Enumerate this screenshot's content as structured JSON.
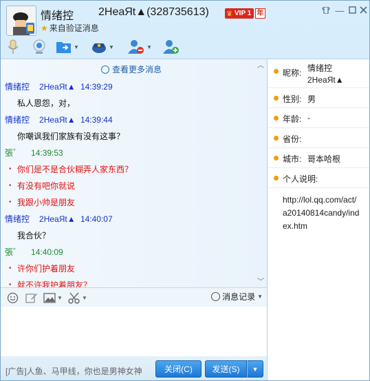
{
  "window": {
    "contact_name": "情绪控",
    "peer_label": "2HeaЯt▲(328735613)",
    "vip_badge": "VIP 1",
    "vip_year": "年",
    "verify_text": "来自验证消息"
  },
  "chat": {
    "more_messages": "查看更多消息",
    "messages": [
      {
        "sender": "情绪控",
        "peer": "2HeaЯt▲",
        "time": "14:39:29",
        "head_color": "blue",
        "lines": [
          "私人恩怨，对，"
        ],
        "text_color": "black"
      },
      {
        "sender": "情绪控",
        "peer": "2HeaЯt▲",
        "time": "14:39:44",
        "head_color": "blue",
        "lines": [
          "你嘲讽我们家族有没有这事？"
        ],
        "text_color": "black"
      },
      {
        "sender": "張゛",
        "peer": "",
        "time": "14:39:53",
        "head_color": "green",
        "lines": [
          "你们是不是合伙糊弄人家东西？",
          "有没有吧你就说",
          "我跟小帅是朋友"
        ],
        "text_color": "red"
      },
      {
        "sender": "情绪控",
        "peer": "2HeaЯt▲",
        "time": "14:40:07",
        "head_color": "blue",
        "lines": [
          "我合伙？"
        ],
        "text_color": "black"
      },
      {
        "sender": "張゛",
        "peer": "",
        "time": "14:40:09",
        "head_color": "green",
        "lines": [
          "许你们护着朋友",
          "就不许我护着朋友？"
        ],
        "text_color": "red"
      }
    ]
  },
  "input_toolbar": {
    "history_label": "消息记录"
  },
  "bottom": {
    "ad_text": "[广告]人鱼、马甲线，你也是男神女神",
    "close_label": "关闭(C)",
    "send_label": "发送(S)"
  },
  "profile": {
    "nickname_label": "昵称:",
    "nickname_value": "情绪控     2HeaЯt▲",
    "gender_label": "性别:",
    "gender_value": "男",
    "age_label": "年龄:",
    "age_value": "-",
    "province_label": "省份:",
    "province_value": "",
    "city_label": "城市:",
    "city_value": "哥本哈根",
    "bio_label": "个人说明:",
    "bio_value": "http://lol.qq.com/act/a20140814candy/index.htm"
  },
  "colors": {
    "blue_head": "#1433c8",
    "green_head": "#1c8a2c",
    "red_text": "#e31212",
    "button_blue": "#1c78d4",
    "dot_orange": "#f39c12"
  }
}
